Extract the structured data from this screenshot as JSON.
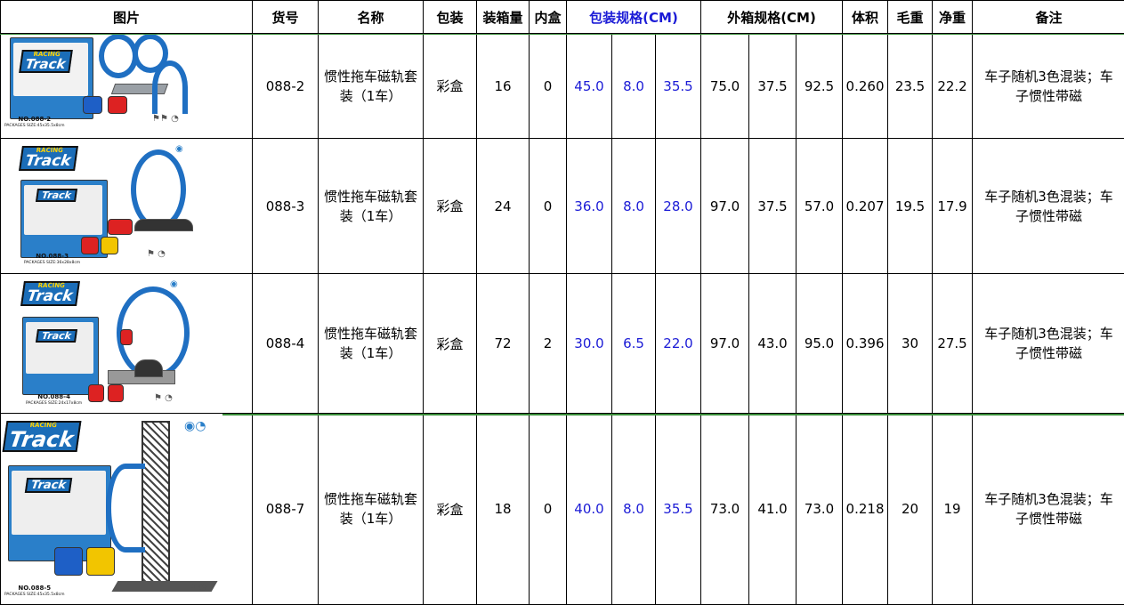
{
  "headers": {
    "pic": "图片",
    "item_no": "货号",
    "name": "名称",
    "packing": "包装",
    "qty": "装箱量",
    "inner": "内盒",
    "pack_size": "包装规格(CM)",
    "carton_size": "外箱规格(CM)",
    "volume": "体积",
    "gross": "毛重",
    "net": "净重",
    "note": "备注"
  },
  "rows": [
    {
      "image": {
        "logo": "Track",
        "logo_top": "RACING",
        "code": "NO.088-2",
        "pack_text": "PACKAGES SIZE:45x35.5x8cm"
      },
      "item_no": "088-2",
      "name": "惯性拖车磁轨套装（1车）",
      "packing": "彩盒",
      "qty": "16",
      "inner": "0",
      "pack": [
        "45.0",
        "8.0",
        "35.5"
      ],
      "carton": [
        "75.0",
        "37.5",
        "92.5"
      ],
      "volume": "0.260",
      "gross": "23.5",
      "net": "22.2",
      "note": "车子随机3色混装；车子惯性带磁"
    },
    {
      "image": {
        "logo": "Track",
        "logo_top": "RACING",
        "code": "NO.088-3",
        "pack_text": "PACKAGES SIZE:36x28x8cm"
      },
      "item_no": "088-3",
      "name": "惯性拖车磁轨套装（1车）",
      "packing": "彩盒",
      "qty": "24",
      "inner": "0",
      "pack": [
        "36.0",
        "8.0",
        "28.0"
      ],
      "carton": [
        "97.0",
        "37.5",
        "57.0"
      ],
      "volume": "0.207",
      "gross": "19.5",
      "net": "17.9",
      "note": "车子随机3色混装；车子惯性带磁"
    },
    {
      "image": {
        "logo": "Track",
        "logo_top": "RACING",
        "code": "NO.088-4",
        "pack_text": "PACKAGES SIZE:24x17x8cm"
      },
      "item_no": "088-4",
      "name": "惯性拖车磁轨套装（1车）",
      "packing": "彩盒",
      "qty": "72",
      "inner": "2",
      "pack": [
        "30.0",
        "6.5",
        "22.0"
      ],
      "carton": [
        "97.0",
        "43.0",
        "95.0"
      ],
      "volume": "0.396",
      "gross": "30",
      "net": "27.5",
      "note": "车子随机3色混装；车子惯性带磁"
    },
    {
      "image": {
        "logo": "Track",
        "logo_top": "RACING",
        "code": "NO.088-5",
        "pack_text": "PACKAGES SIZE:45x35.5x8cm"
      },
      "item_no": "088-7",
      "name": "惯性拖车磁轨套装（1车）",
      "packing": "彩盒",
      "qty": "18",
      "inner": "0",
      "pack": [
        "40.0",
        "8.0",
        "35.5"
      ],
      "carton": [
        "73.0",
        "41.0",
        "73.0"
      ],
      "volume": "0.218",
      "gross": "20",
      "net": "19",
      "note": "车子随机3色混装；车子惯性带磁"
    }
  ],
  "colors": {
    "accent_blue": "#1b1bd6",
    "divider_green": "#3a8f3a",
    "track_blue": "#1f6fc2"
  }
}
